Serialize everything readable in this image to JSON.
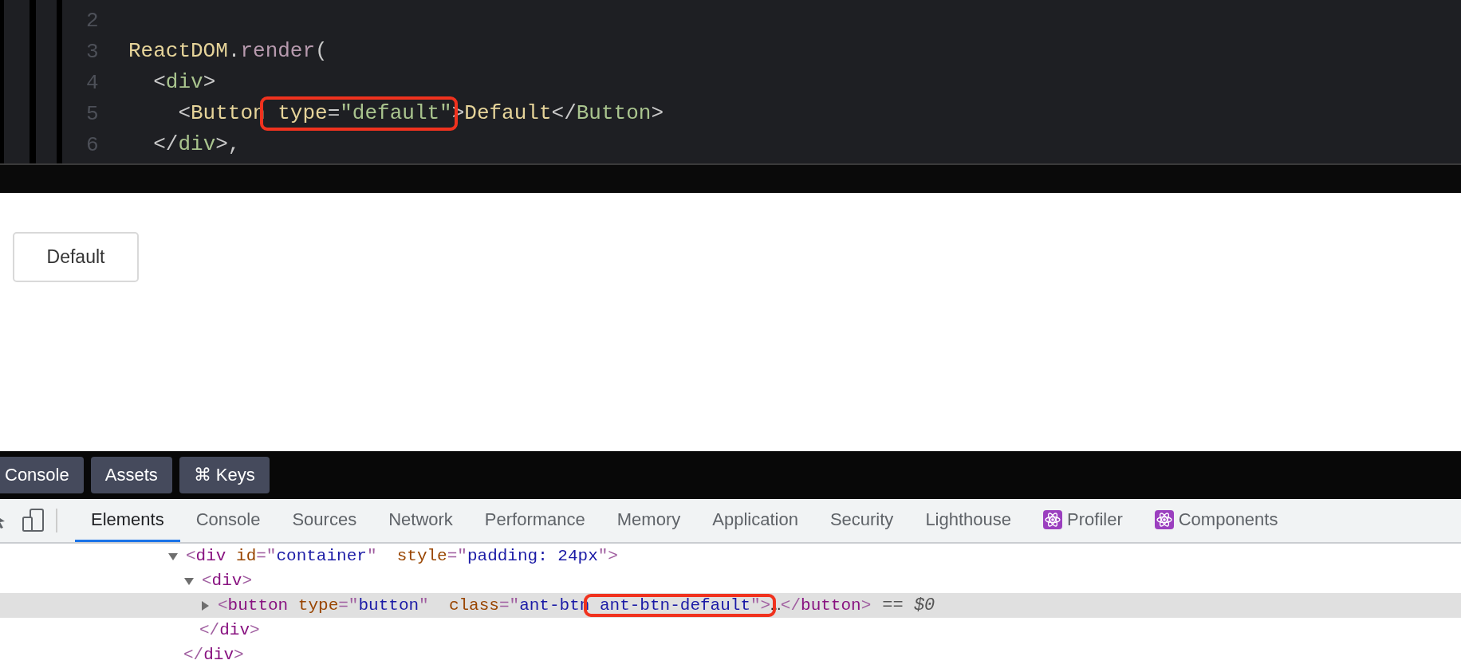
{
  "editor": {
    "lines": [
      {
        "number": "2"
      },
      {
        "number": "3",
        "tokens": [
          {
            "text": "ReactDOM",
            "kind": "object"
          },
          {
            "text": ".",
            "kind": "punct"
          },
          {
            "text": "render",
            "kind": "method"
          },
          {
            "text": "(",
            "kind": "punct"
          }
        ]
      },
      {
        "number": "4",
        "tokens": [
          {
            "text": "  <",
            "kind": "punct"
          },
          {
            "text": "div",
            "kind": "tag"
          },
          {
            "text": ">",
            "kind": "punct"
          }
        ]
      },
      {
        "number": "5",
        "tokens": [
          {
            "text": "    <",
            "kind": "punct"
          },
          {
            "text": "Button",
            "kind": "component"
          },
          {
            "text": " type",
            "kind": "attr",
            "highlight": true
          },
          {
            "text": "=",
            "kind": "punct",
            "highlight": true
          },
          {
            "text": "\"default\"",
            "kind": "string",
            "highlight": true
          },
          {
            "text": ">",
            "kind": "punct"
          },
          {
            "text": "Default",
            "kind": "component"
          },
          {
            "text": "</",
            "kind": "punct"
          },
          {
            "text": "Button",
            "kind": "tag"
          },
          {
            "text": ">",
            "kind": "punct"
          }
        ]
      },
      {
        "number": "6",
        "tokens": [
          {
            "text": "  </",
            "kind": "punct"
          },
          {
            "text": "div",
            "kind": "tag"
          },
          {
            "text": ">,",
            "kind": "punct"
          }
        ]
      }
    ]
  },
  "preview": {
    "button": {
      "label": "Default"
    }
  },
  "toolbar_buttons": [
    "Console",
    "Assets",
    "⌘ Keys"
  ],
  "devtools_tabs": [
    {
      "label": "Elements",
      "kind": "plain",
      "selected": true
    },
    {
      "label": "Console",
      "kind": "plain",
      "selected": false
    },
    {
      "label": "Sources",
      "kind": "plain",
      "selected": false
    },
    {
      "label": "Network",
      "kind": "plain",
      "selected": false
    },
    {
      "label": "Performance",
      "kind": "plain",
      "selected": false
    },
    {
      "label": "Memory",
      "kind": "plain",
      "selected": false
    },
    {
      "label": "Application",
      "kind": "plain",
      "selected": false
    },
    {
      "label": "Security",
      "kind": "plain",
      "selected": false
    },
    {
      "label": "Lighthouse",
      "kind": "plain",
      "selected": false
    },
    {
      "label": "Profiler",
      "kind": "react",
      "selected": false
    },
    {
      "label": "Components",
      "kind": "react",
      "selected": false
    }
  ],
  "dom_tree": [
    {
      "expanded": true,
      "selected": false,
      "tokens": [
        {
          "text": "<",
          "kind": "punct"
        },
        {
          "text": "div",
          "kind": "tag"
        },
        {
          "text": " id",
          "kind": "attr"
        },
        {
          "text": "=\"",
          "kind": "punct"
        },
        {
          "text": "container",
          "kind": "value"
        },
        {
          "text": "\"",
          "kind": "punct"
        },
        {
          "text": "  style",
          "kind": "attr"
        },
        {
          "text": "=\"",
          "kind": "punct"
        },
        {
          "text": "padding: 24px",
          "kind": "value"
        },
        {
          "text": "\">",
          "kind": "punct"
        }
      ],
      "children": [
        {
          "expanded": true,
          "selected": false,
          "tokens": [
            {
              "text": "<",
              "kind": "punct"
            },
            {
              "text": "div",
              "kind": "tag"
            },
            {
              "text": ">",
              "kind": "punct"
            }
          ],
          "children": [
            {
              "expanded": false,
              "selected": true,
              "suffix": "== $0",
              "tokens": [
                {
                  "text": "<",
                  "kind": "punct"
                },
                {
                  "text": "button",
                  "kind": "tag"
                },
                {
                  "text": " type",
                  "kind": "attr"
                },
                {
                  "text": "=\"",
                  "kind": "punct"
                },
                {
                  "text": "button",
                  "kind": "value"
                },
                {
                  "text": "\"",
                  "kind": "punct"
                },
                {
                  "text": "  class",
                  "kind": "attr"
                },
                {
                  "text": "=\"",
                  "kind": "punct"
                },
                {
                  "text": "ant-btn",
                  "kind": "value"
                },
                {
                  "text": " ant-btn-default",
                  "kind": "value",
                  "highlight": true
                },
                {
                  "text": "\">",
                  "kind": "punct",
                  "highlight": true
                },
                {
                  "text": "…",
                  "kind": "text"
                },
                {
                  "text": "</",
                  "kind": "punct"
                },
                {
                  "text": "button",
                  "kind": "tag"
                },
                {
                  "text": ">",
                  "kind": "punct"
                }
              ]
            }
          ],
          "closing": [
            {
              "text": "</",
              "kind": "punct"
            },
            {
              "text": "div",
              "kind": "tag"
            },
            {
              "text": ">",
              "kind": "punct"
            }
          ]
        }
      ],
      "closing": [
        {
          "text": "</",
          "kind": "punct"
        },
        {
          "text": "div",
          "kind": "tag"
        },
        {
          "text": ">",
          "kind": "punct"
        }
      ]
    }
  ]
}
